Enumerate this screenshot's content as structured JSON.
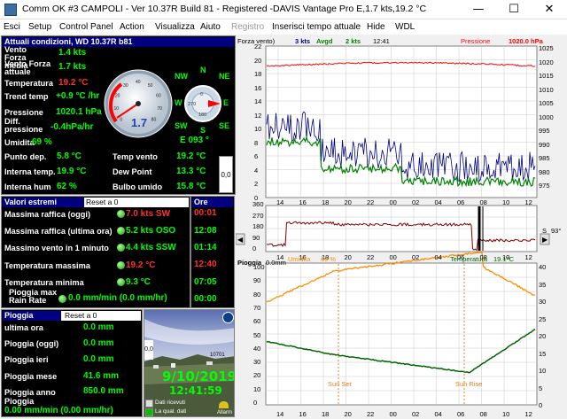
{
  "window": {
    "title": "Comm OK  #3 CAMPOLI - Ver 10.37R Build 81 - Registered  -DAVIS Vantage Pro   E,1.7 kts,19.2 °C",
    "min": "—",
    "max": "☐",
    "close": "✕"
  },
  "menu": {
    "esci": "Esci",
    "setup": "Setup",
    "control_panel": "Control Panel",
    "action": "Action",
    "visualizza": "Visualizza",
    "aiuto": "Aiuto",
    "registro": "Registro",
    "inserisci": "Inserisci tempo attuale",
    "hide": "Hide",
    "wdl": "WDL"
  },
  "current": {
    "header": "Attuali condizioni, WD 10.37R b81",
    "vento_label": "Vento Forza media",
    "vento_value": "1.4 kts",
    "vento_att_label": "Vento Forza attuale",
    "vento_att_value": "1.7 kts",
    "temp_label": "Temperatura",
    "temp_value": "19.2 °C",
    "trend_label": "Trend temp",
    "trend_value": "+0.9 °C /hr",
    "press_label": "Pressione",
    "press_value": "1020.1 hPa",
    "diff_label": "Diff. pressione",
    "diff_value": "-0.4hPa/hr",
    "umid_label": "Umidita",
    "umid_value": "69 %",
    "dir_value": "E  093 °",
    "punto_label": "Punto dep.",
    "punto_value": "5.8 °C",
    "tv_label": "Temp vento",
    "tv_value": "19.2 °C",
    "it_label": "Interna temp.",
    "it_value": "19.9 °C",
    "dp_label": "Dew Point",
    "dp_value": "13.3 °C",
    "ih_label": "Interna hum",
    "ih_value": "62 %",
    "bu_label": "Bulbo umido",
    "bu_value": "15.8 °C",
    "gauge_value": "1.7",
    "gauge_ticks": [
      "0",
      "10",
      "20",
      "30",
      "40",
      "50",
      "60",
      "70",
      "80"
    ],
    "compass": {
      "n": "N",
      "ne": "NE",
      "e": "E",
      "se": "SE",
      "s": "S",
      "sw": "SW",
      "w": "W",
      "nw": "NW",
      "inner_n": "0",
      "inner_e": "90",
      "inner_s": "180",
      "inner_w": "270"
    },
    "side_value": "0,0"
  },
  "extremes": {
    "header": "Valori estremi",
    "reset": "Reset a 0",
    "ore_header": "Ore",
    "rows": [
      {
        "label": "Massima raffica (oggi)",
        "value": "7.0 kts SW",
        "time": "00:01"
      },
      {
        "label": "Massima raffica (ultima ora)",
        "value": "5.2 kts OSO",
        "time": "12:08"
      },
      {
        "label": "Massimo vento in 1 minuto",
        "value": "4.4 kts SSW",
        "time": "01:14"
      },
      {
        "label": "Temperatura massima",
        "value": "19.2 °C",
        "time": "12:40"
      },
      {
        "label": "Temperatura minima",
        "value": "9.3 °C",
        "time": "07:05"
      },
      {
        "label": "Pioggia max Rain Rate",
        "value": "0.0 mm/min (0.0 mm/hr)",
        "time": "00:00"
      }
    ]
  },
  "rain": {
    "header": "Pioggia",
    "reset": "Reset a 0",
    "ora_label": "ultima ora",
    "ora_value": "0.0 mm",
    "oggi_label": "Pioggia (oggi)",
    "oggi_value": "0.0 mm",
    "ieri_label": "Pioggia ieri",
    "ieri_value": "0.0 mm",
    "mese_label": "Pioggia mese",
    "mese_value": "41.6 mm",
    "anno_label": "Pioggia anno",
    "anno_value": "850.0 mm",
    "rate_label": "Pioggia",
    "rate_value": "0.00 mm/min (0.00 mm/hr)"
  },
  "camera": {
    "date": "9/10/2019",
    "time": "12:41:59",
    "counter": "10701",
    "side_value": "0,0",
    "legend_ricevuti": "Dati ricevuti",
    "legend_qual": "La qual. dati",
    "allarm": "Allarm"
  },
  "graphs": {
    "top": {
      "forza_label": "Forza vento)",
      "kts1": "3 kts",
      "avgd": "Avgd",
      "kts2": "2 kts",
      "time": "12:41",
      "press_label": "Pressione",
      "press_value": "1020.0 hPa",
      "y_left": [
        "22",
        "20",
        "18",
        "16",
        "14",
        "12",
        "10",
        "8",
        "6",
        "4",
        "2",
        "0"
      ],
      "y_right": [
        "1025",
        "1020",
        "1015",
        "1010",
        "1005",
        "1000",
        "995",
        "990",
        "985",
        "980",
        "975"
      ]
    },
    "mid": {
      "y_left": [
        "360",
        "270",
        "180",
        "90",
        "0"
      ],
      "y_right": [
        "93°"
      ],
      "side_letter": "S",
      "x": [
        "14",
        "16",
        "18",
        "20",
        "22",
        "00",
        "02",
        "04",
        "06",
        "08",
        "10",
        "12"
      ]
    },
    "bottom": {
      "pioggia_label": "Pioggia",
      "pioggia_value": "0.0mm",
      "umid_label": "Umidita",
      "umid_value": "69 %",
      "temp_label": "Temperatura",
      "temp_value": "19.1°C",
      "y_left": [
        "100",
        "90",
        "80",
        "70",
        "60",
        "50",
        "40",
        "30",
        "20",
        "10",
        "0"
      ],
      "y_right": [
        "40",
        "35",
        "30",
        "25",
        "20",
        "15",
        "10",
        "5",
        "0"
      ],
      "sun_set": "Sun Set",
      "sun_rise": "Sun Rise",
      "x": [
        "14",
        "16",
        "18",
        "20",
        "22",
        "00",
        "02",
        "04",
        "06",
        "08",
        "10",
        "12"
      ]
    }
  },
  "colors": {
    "panel_bg": "#000000",
    "header_bg": "#000080",
    "value_green": "#00ff00",
    "value_red": "#ff3030",
    "pressure_line": "#ff0000",
    "wind_line": "#000080",
    "avg_line": "#008000",
    "humidity_line": "#ff8c00",
    "temp_line": "#006400",
    "direction_line": "#800000"
  }
}
